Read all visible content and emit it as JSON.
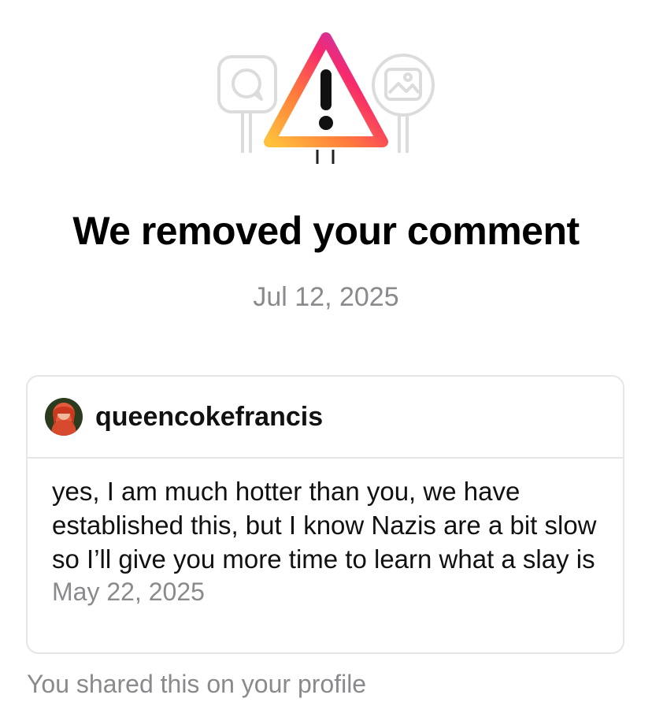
{
  "notice": {
    "title": "We removed your comment",
    "date": "Jul 12, 2025"
  },
  "comment_card": {
    "username": "queencokefrancis",
    "avatar_icon": "profile-photo",
    "text": "yes, I am much hotter than you, we have established this, but I know Nazis are a bit slow so I’ll give you more time to learn what a slay is",
    "date": "May 22, 2025"
  },
  "footer": {
    "note": "You shared this on your profile"
  },
  "colors": {
    "gradient_start": "#FFB63B",
    "gradient_mid": "#F72A6B",
    "gradient_end": "#A53BD9",
    "secondary_text": "#8A8A8E",
    "card_border": "#E6E6E8"
  }
}
